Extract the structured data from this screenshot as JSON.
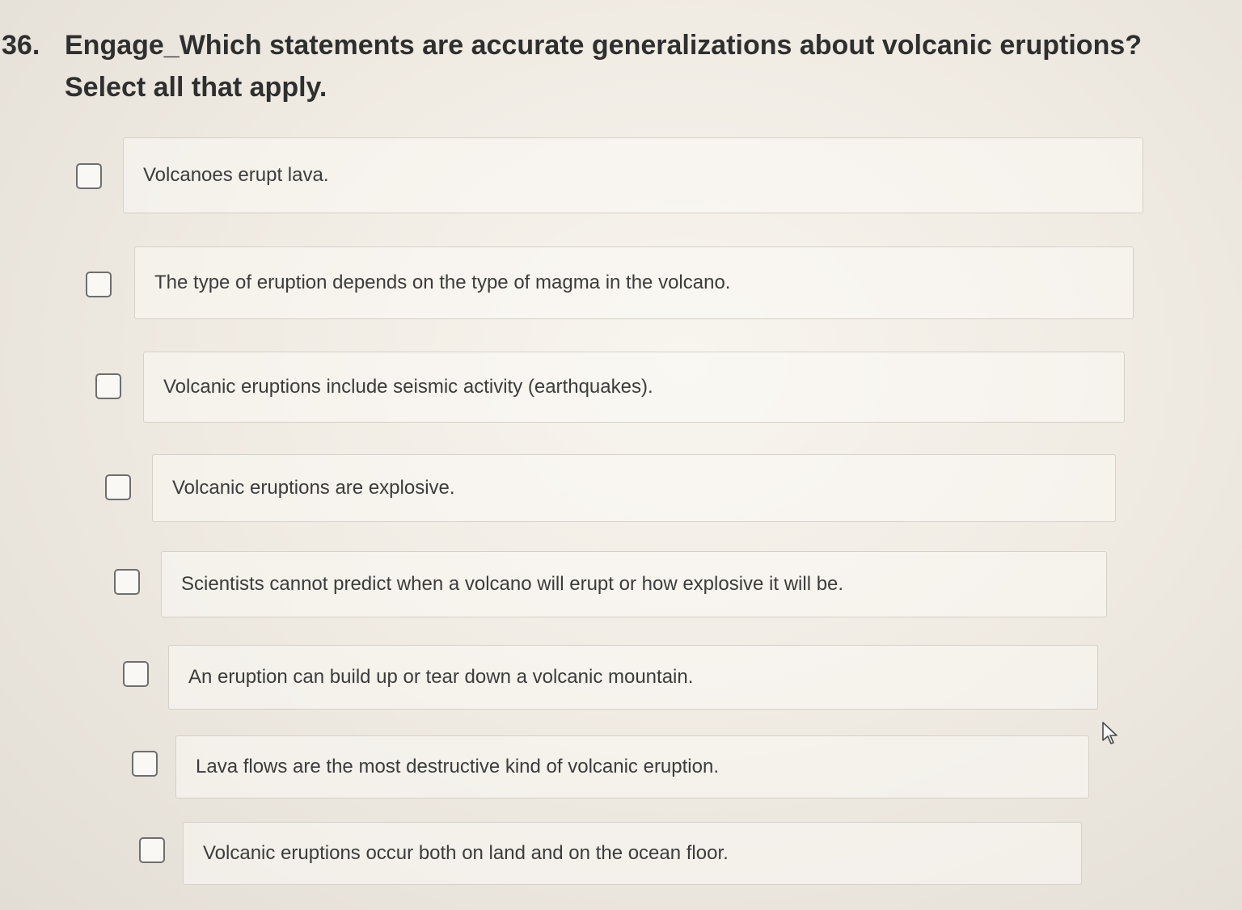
{
  "question": {
    "number": "36.",
    "text": "Engage_Which statements are accurate generalizations about volcanic eruptions? Select all that apply."
  },
  "options": [
    {
      "label": "Volcanoes erupt lava.",
      "checked": false
    },
    {
      "label": "The type of eruption depends on the type of magma in the volcano.",
      "checked": false
    },
    {
      "label": "Volcanic eruptions include seismic activity (earthquakes).",
      "checked": false
    },
    {
      "label": "Volcanic eruptions are explosive.",
      "checked": false
    },
    {
      "label": "Scientists cannot predict when a volcano will erupt or how explosive it will be.",
      "checked": false
    },
    {
      "label": "An eruption can build up or tear down a volcanic mountain.",
      "checked": false
    },
    {
      "label": "Lava flows are the most destructive kind of volcanic eruption.",
      "checked": false
    },
    {
      "label": "Volcanic eruptions occur both on land and on the ocean floor.",
      "checked": false
    }
  ],
  "colors": {
    "background": "#ece7df",
    "checkbox_border": "#6e6e6e",
    "answer_border": "#d6d1c8",
    "text": "#3c3c3c"
  },
  "icons": {
    "cursor": "mouse-pointer-icon"
  }
}
